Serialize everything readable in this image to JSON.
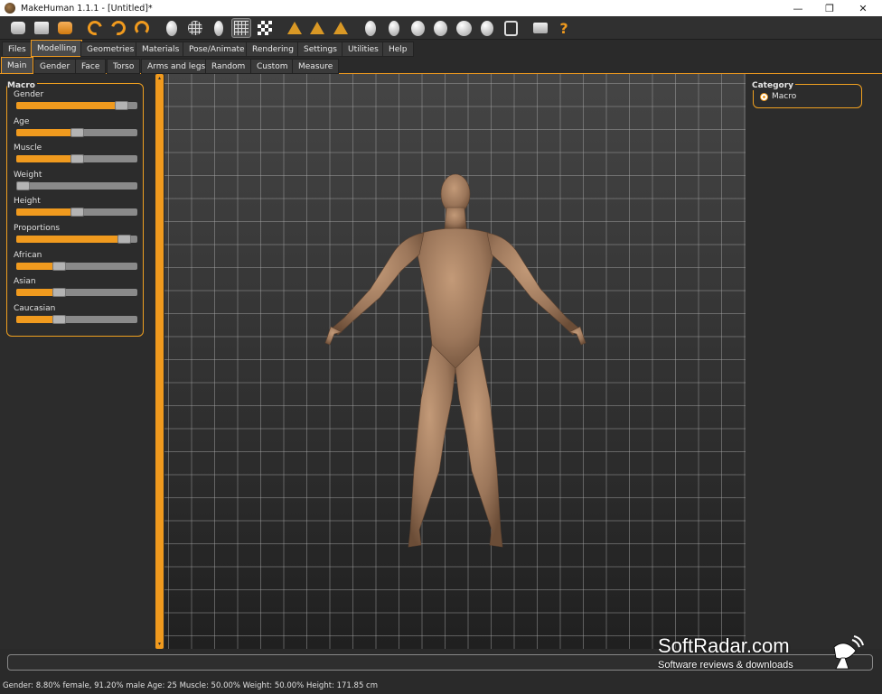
{
  "window": {
    "title": "MakeHuman 1.1.1 - [Untitled]*",
    "controls": {
      "minimize": "—",
      "restore": "❐",
      "close": "✕"
    }
  },
  "toolbar": {
    "icons": [
      "new-icon",
      "save-icon",
      "export-icon",
      "undo-icon",
      "redo-icon",
      "reset-icon",
      "smooth-icon",
      "wireframe-icon",
      "pose-icon",
      "grid-icon",
      "background-icon",
      "front-view-icon",
      "side-view-icon",
      "back-view-icon",
      "face-front-icon",
      "face-side-icon",
      "head-icon",
      "skull-icon",
      "body-icon",
      "legs-icon",
      "reset-camera-icon",
      "screenshot-icon",
      "help-icon"
    ],
    "help_glyph": "?"
  },
  "tabs": {
    "main": [
      "Files",
      "Modelling",
      "Geometries",
      "Materials",
      "Pose/Animate",
      "Rendering",
      "Settings",
      "Utilities",
      "Help"
    ],
    "main_selected": "Modelling",
    "sub": [
      "Main",
      "Gender",
      "Face",
      "Torso",
      "Arms and legs",
      "Random",
      "Custom",
      "Measure"
    ],
    "sub_selected": "Main"
  },
  "left_panel": {
    "group_title": "Macro",
    "sliders": [
      {
        "label": "Gender",
        "value": 0.912
      },
      {
        "label": "Age",
        "value": 0.5
      },
      {
        "label": "Muscle",
        "value": 0.5
      },
      {
        "label": "Weight",
        "value": 0.0
      },
      {
        "label": "Height",
        "value": 0.5
      },
      {
        "label": "Proportions",
        "value": 0.94
      },
      {
        "label": "African",
        "value": 0.333
      },
      {
        "label": "Asian",
        "value": 0.333
      },
      {
        "label": "Caucasian",
        "value": 0.333
      }
    ]
  },
  "right_panel": {
    "group_title": "Category",
    "options": [
      {
        "label": "Macro",
        "selected": true
      }
    ]
  },
  "status": {
    "text": "Gender: 8.80% female, 91.20% male Age: 25 Muscle: 50.00% Weight: 50.00% Height: 171.85 cm"
  },
  "watermark": {
    "title": "SoftRadar.com",
    "subtitle": "Software reviews & downloads"
  },
  "colors": {
    "accent": "#f09a1e",
    "background": "#2b2b2b",
    "skin": "#a07a5a"
  }
}
